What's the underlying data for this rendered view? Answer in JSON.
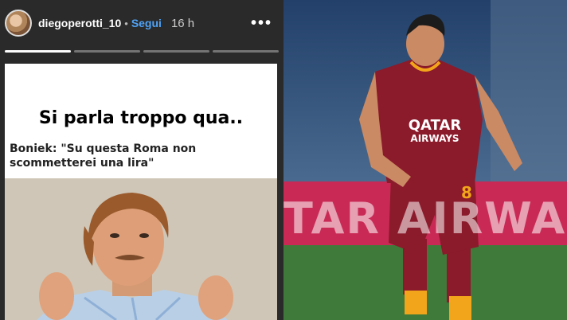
{
  "story": {
    "username": "diegoperotti_10",
    "separator": "•",
    "follow_label": "Segui",
    "time_ago": "16 h",
    "more_icon": "more-options-icon",
    "progress_segments": 4,
    "active_segment": 1
  },
  "meme": {
    "title": "Si parla troppo qua..",
    "caption": "Boniek: \"Su questa Roma non scommetterei una lira\""
  },
  "player_photo": {
    "banner_text": "TAR AIRWA",
    "sponsor_line1": "QATAR",
    "sponsor_line2": "AIRWAYS",
    "shirt_number": "8",
    "colors": {
      "jersey": "#8b1a2b",
      "accent": "#f2a51a",
      "pitch": "#3f7a3a",
      "stands": "#2f4d77",
      "banner": "#c92a55"
    }
  }
}
